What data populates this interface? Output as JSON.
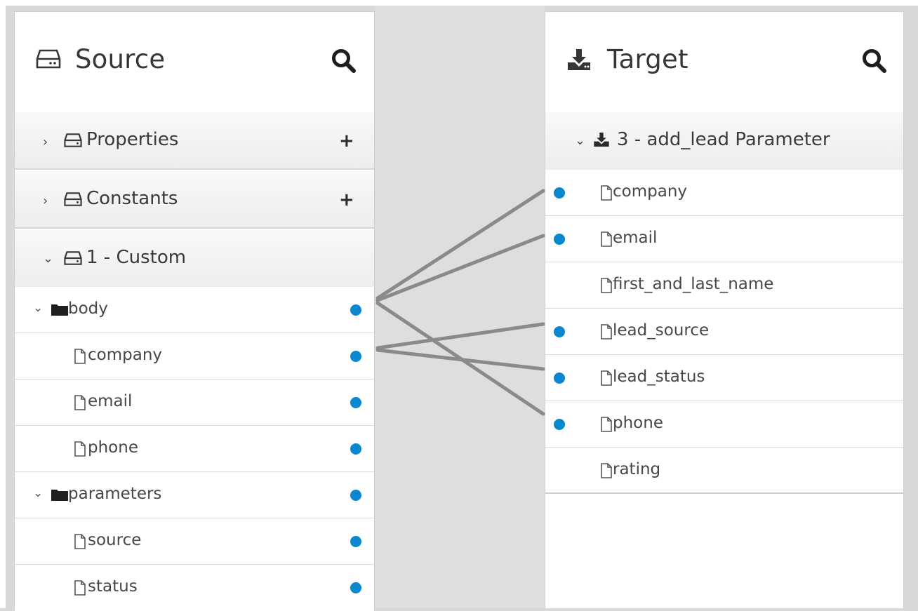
{
  "colors": {
    "connector_dot": "#0a88cf",
    "mapping_line": "#8a8a8a",
    "divider": "#d6d6d6"
  },
  "source": {
    "title": "Source",
    "header_icon": "hdd-icon",
    "search_icon": "search-icon",
    "groups": [
      {
        "label": "Properties",
        "expanded": false,
        "action": "+"
      },
      {
        "label": "Constants",
        "expanded": false,
        "action": "+"
      },
      {
        "label": "1 - Custom",
        "expanded": true
      }
    ],
    "fields": [
      {
        "label": "body",
        "type": "folder",
        "expanded": true,
        "mapped": true
      },
      {
        "label": "company",
        "type": "file",
        "mapped": true
      },
      {
        "label": "email",
        "type": "file",
        "mapped": true
      },
      {
        "label": "phone",
        "type": "file",
        "mapped": true
      },
      {
        "label": "parameters",
        "type": "folder",
        "expanded": true,
        "mapped": true
      },
      {
        "label": "source",
        "type": "file",
        "mapped": true
      },
      {
        "label": "status",
        "type": "file",
        "mapped": true
      }
    ]
  },
  "target": {
    "title": "Target",
    "header_icon": "download-icon",
    "search_icon": "search-icon",
    "group": {
      "label": "3 - add_lead Parameter",
      "expanded": true
    },
    "fields": [
      {
        "label": "company",
        "mapped": true
      },
      {
        "label": "email",
        "mapped": true
      },
      {
        "label": "first_and_last_name",
        "mapped": false
      },
      {
        "label": "lead_source",
        "mapped": true
      },
      {
        "label": "lead_status",
        "mapped": true
      },
      {
        "label": "phone",
        "mapped": true
      },
      {
        "label": "rating",
        "mapped": false
      }
    ]
  }
}
